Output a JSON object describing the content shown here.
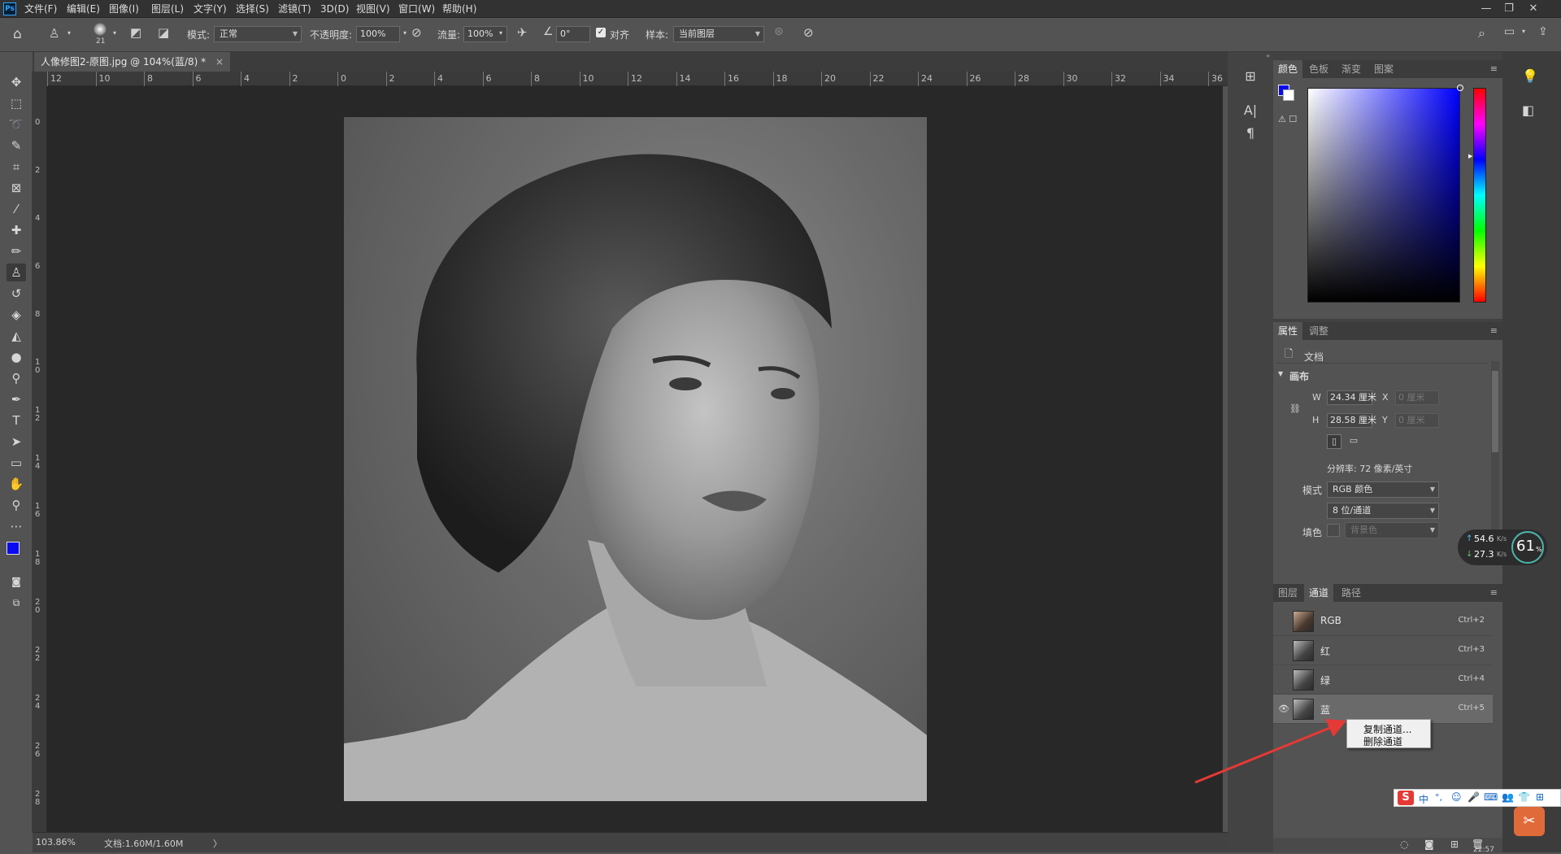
{
  "app": {
    "logo": "Ps"
  },
  "menu": [
    "文件(F)",
    "编辑(E)",
    "图像(I)",
    "图层(L)",
    "文字(Y)",
    "选择(S)",
    "滤镜(T)",
    "3D(D)",
    "视图(V)",
    "窗口(W)",
    "帮助(H)"
  ],
  "window_controls": [
    "—",
    "❐",
    "✕"
  ],
  "options": {
    "brush_size": "21",
    "mode_label": "模式:",
    "mode_value": "正常",
    "opacity_label": "不透明度:",
    "opacity_value": "100%",
    "flow_label": "流量:",
    "flow_value": "100%",
    "angle_value": "0°",
    "aligned_label": "对齐",
    "sample_label": "样本:",
    "sample_value": "当前图层"
  },
  "doc": {
    "tab_title": "人像修图2-原图.jpg @ 104%(蓝/8) *",
    "close": "×"
  },
  "ruler": {
    "top": [
      "12",
      "10",
      "8",
      "6",
      "4",
      "2",
      "0",
      "2",
      "4",
      "6",
      "8",
      "10",
      "12",
      "14",
      "16",
      "18",
      "20",
      "22",
      "24",
      "26",
      "28",
      "30",
      "32",
      "34",
      "36"
    ],
    "left": [
      "0",
      "2",
      "4",
      "6",
      "8",
      "1 0",
      "1 2",
      "1 4",
      "1 6",
      "1 8",
      "2 0",
      "2 2",
      "2 4",
      "2 6",
      "2 8"
    ]
  },
  "status": {
    "zoom": "103.86%",
    "doc_size": "文档:1.60M/1.60M",
    "arrow": "〉"
  },
  "color_panel": {
    "tabs": [
      "颜色",
      "色板",
      "渐变",
      "图案"
    ],
    "foreground": "#0a0af0",
    "background": "#ffffff"
  },
  "properties_panel": {
    "tabs": [
      "属性",
      "调整"
    ],
    "doc_label": "文档",
    "section": "画布",
    "w_label": "W",
    "w_value": "24.34 厘米",
    "h_label": "H",
    "h_value": "28.58 厘米",
    "x_label": "X",
    "x_value": "0 厘米",
    "y_label": "Y",
    "y_value": "0 厘米",
    "resolution": "分辨率: 72 像素/英寸",
    "mode_label": "模式",
    "mode_value": "RGB 颜色",
    "depth_value": "8 位/通道",
    "fill_label": "填色",
    "fill_value": "背景色"
  },
  "channels_panel": {
    "tabs": [
      "图层",
      "通道",
      "路径"
    ],
    "rows": [
      {
        "name": "RGB",
        "shortcut": "Ctrl+2"
      },
      {
        "name": "红",
        "shortcut": "Ctrl+3"
      },
      {
        "name": "绿",
        "shortcut": "Ctrl+4"
      },
      {
        "name": "蓝",
        "shortcut": "Ctrl+5"
      }
    ]
  },
  "context_menu": [
    "复制通道...",
    "删除通道"
  ],
  "net_widget": {
    "up": "54.6",
    "down": "27.3",
    "unit": "K/s",
    "percent": "61",
    "percent_sign": "%"
  },
  "ime": {
    "logo": "S",
    "lang": "中",
    "items": [
      "°,",
      "☺",
      "🎤",
      "⌨",
      "👥",
      "👕",
      "⊞"
    ]
  },
  "clock": "22:57",
  "colors": {
    "accent_red": "#e53935",
    "selected_fg": "#0a0af0"
  }
}
